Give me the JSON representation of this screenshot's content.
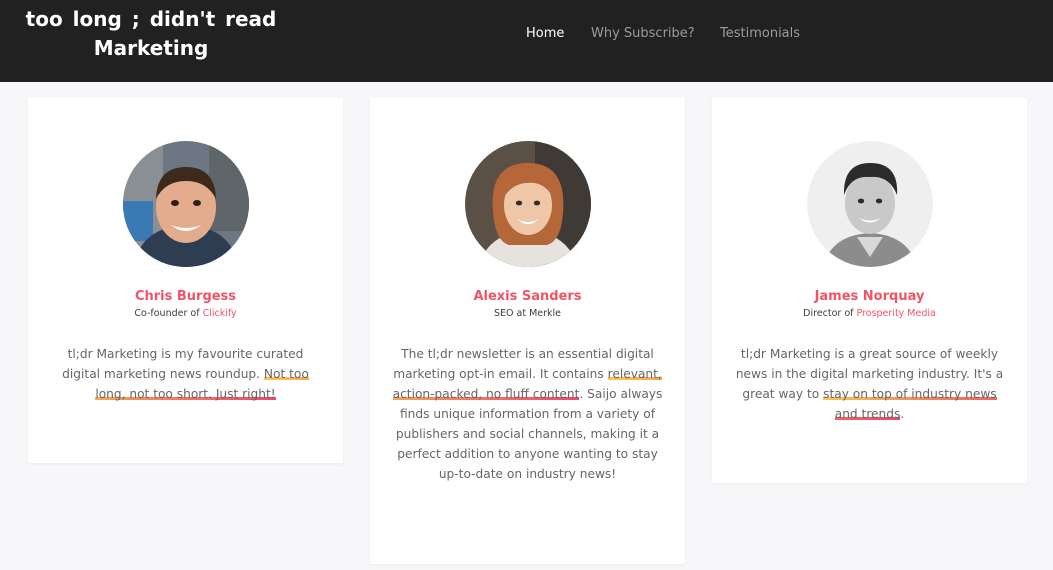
{
  "site": {
    "title_line1": "too long ; didn't read",
    "title_line2": "Marketing"
  },
  "nav": [
    {
      "label": "Home",
      "active": true
    },
    {
      "label": "Why Subscribe?",
      "active": false
    },
    {
      "label": "Testimonials",
      "active": false
    }
  ],
  "testimonials": [
    {
      "name": "Chris Burgess",
      "role_prefix": "Co-founder of ",
      "company": "Clickify",
      "quote_pre": "tl;dr Marketing is my favourite curated digital marketing news roundup. ",
      "quote_highlight": "Not too long, not too short. Just right!",
      "quote_post": ""
    },
    {
      "name": "Alexis Sanders",
      "role_prefix": "SEO at Merkle",
      "company": "",
      "quote_pre": "The tl;dr newsletter is an essential digital marketing opt-in email. It contains ",
      "quote_highlight": "relevant, action-packed, no fluff content",
      "quote_post": ". Saijo always finds unique information from a variety of publishers and social channels, making it a perfect addition to anyone wanting to stay up-to-date on industry news!"
    },
    {
      "name": "James Norquay",
      "role_prefix": "Director of ",
      "company": "Prosperity Media",
      "quote_pre": "tl;dr Marketing is a great source of weekly news in the digital marketing industry. It's a great way to ",
      "quote_highlight": "stay on top of industry news and trends",
      "quote_post": "."
    }
  ],
  "colors": {
    "header_bg": "#212121",
    "accent": "#ef5467",
    "page_bg": "#f7f7f9"
  }
}
